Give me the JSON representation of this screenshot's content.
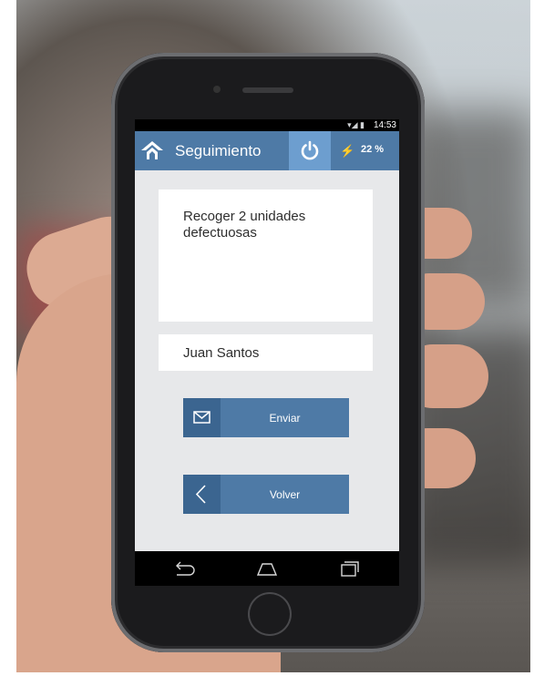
{
  "status_bar": {
    "time": "14:53"
  },
  "app_bar": {
    "title": "Seguimiento",
    "battery_percent": "22 %"
  },
  "form": {
    "message_text": "Recoger 2 unidades defectuosas",
    "recipient_name": "Juan Santos"
  },
  "buttons": {
    "send_label": "Enviar",
    "back_label": "Volver"
  },
  "colors": {
    "primary": "#4e7aa6",
    "primary_dark": "#3b6590",
    "accent": "#6d9ecf",
    "background": "#e7e8ea"
  },
  "icons": [
    "logo-icon",
    "power-icon",
    "battery-icon",
    "mail-icon",
    "chevron-left-icon",
    "nav-back-icon",
    "nav-home-icon",
    "nav-recents-icon"
  ]
}
